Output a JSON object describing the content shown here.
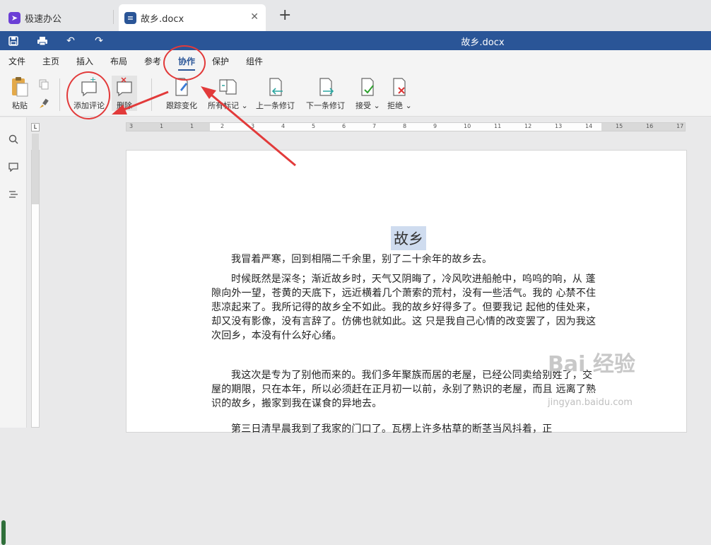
{
  "tabs": [
    {
      "label": "极速办公",
      "icon": "rocket-app-icon",
      "color": "#6b3fd6"
    },
    {
      "label": "故乡.docx",
      "icon": "document-icon",
      "color": "#2a5597"
    }
  ],
  "window": {
    "title": "故乡.docx"
  },
  "menu": [
    "文件",
    "主页",
    "插入",
    "布局",
    "参考",
    "协作",
    "保护",
    "组件"
  ],
  "menu_active": "协作",
  "toolbar": {
    "paste": "粘贴",
    "add_comment": "添加评论",
    "delete": "删除",
    "track_changes": "跟踪变化",
    "markup": "所有标记",
    "prev_change": "上一条修订",
    "next_change": "下一条修订",
    "accept": "接受",
    "reject": "拒绝"
  },
  "ruler_labels": [
    "3",
    "1",
    "1",
    "2",
    "3",
    "4",
    "5",
    "6",
    "7",
    "8",
    "9",
    "10",
    "11",
    "12",
    "13",
    "14",
    "15",
    "16",
    "17"
  ],
  "document": {
    "heading": "故乡",
    "paragraphs": [
      "我冒着严寒，回到相隔二千余里，别了二十余年的故乡去。",
      "时候既然是深冬；渐近故乡时，天气又阴晦了，冷风吹进船舱中，呜呜的响，从 蓬隙向外一望，苍黄的天底下，远近横着几个萧索的荒村，没有一些活气。我的 心禁不住悲凉起来了。我所记得的故乡全不如此。我的故乡好得多了。但要我记 起他的佳处来，却又没有影像，没有言辞了。仿佛也就如此。这 只是我自己心情的改变罢了，因为我这次回乡，本没有什么好心绪。",
      "我这次是专为了别他而来的。我们多年聚族而居的老屋，已经公同卖给别姓了，交屋的期限，只在本年，所以必须赶在正月初一以前，永别了熟识的老屋，而且 远离了熟识的故乡，搬家到我在谋食的异地去。",
      "第三日清早晨我到了我家的门口了。瓦楞上许多枯草的断茎当风抖着，正"
    ]
  },
  "watermark": {
    "text": "Bai 经验",
    "url": "jingyan.baidu.com"
  },
  "accent_color": "#2a5597",
  "annotation_color": "#e23a3a"
}
